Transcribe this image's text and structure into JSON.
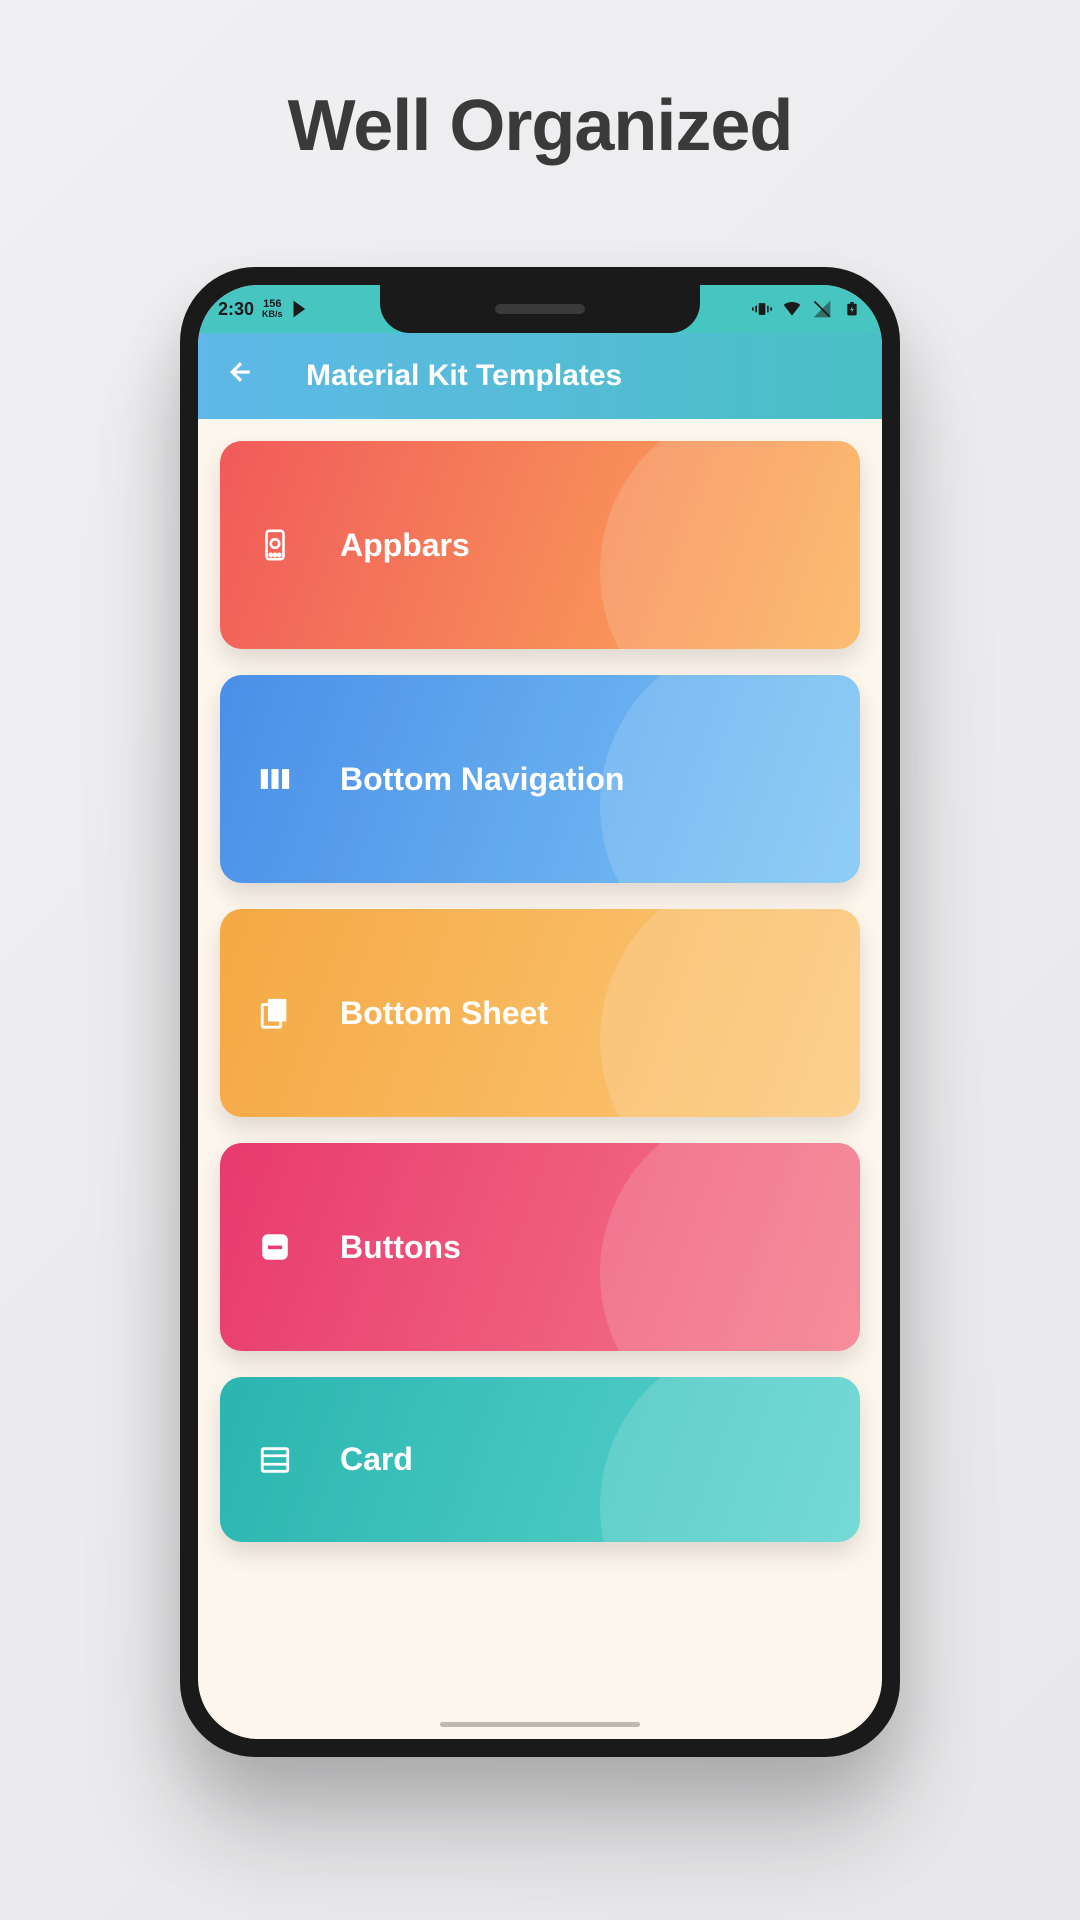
{
  "headline": "Well Organized",
  "status": {
    "time": "2:30",
    "speed_value": "156",
    "speed_unit": "KB/s"
  },
  "header": {
    "title": "Material Kit Templates"
  },
  "cards": [
    {
      "label": "Appbars",
      "icon": "appbars-icon",
      "variant": "appbars"
    },
    {
      "label": "Bottom Navigation",
      "icon": "columns-icon",
      "variant": "bottomnav"
    },
    {
      "label": "Bottom Sheet",
      "icon": "copy-icon",
      "variant": "bottomsheet"
    },
    {
      "label": "Buttons",
      "icon": "minus-square-icon",
      "variant": "buttons"
    },
    {
      "label": "Card",
      "icon": "card-layout-icon",
      "variant": "card"
    }
  ]
}
